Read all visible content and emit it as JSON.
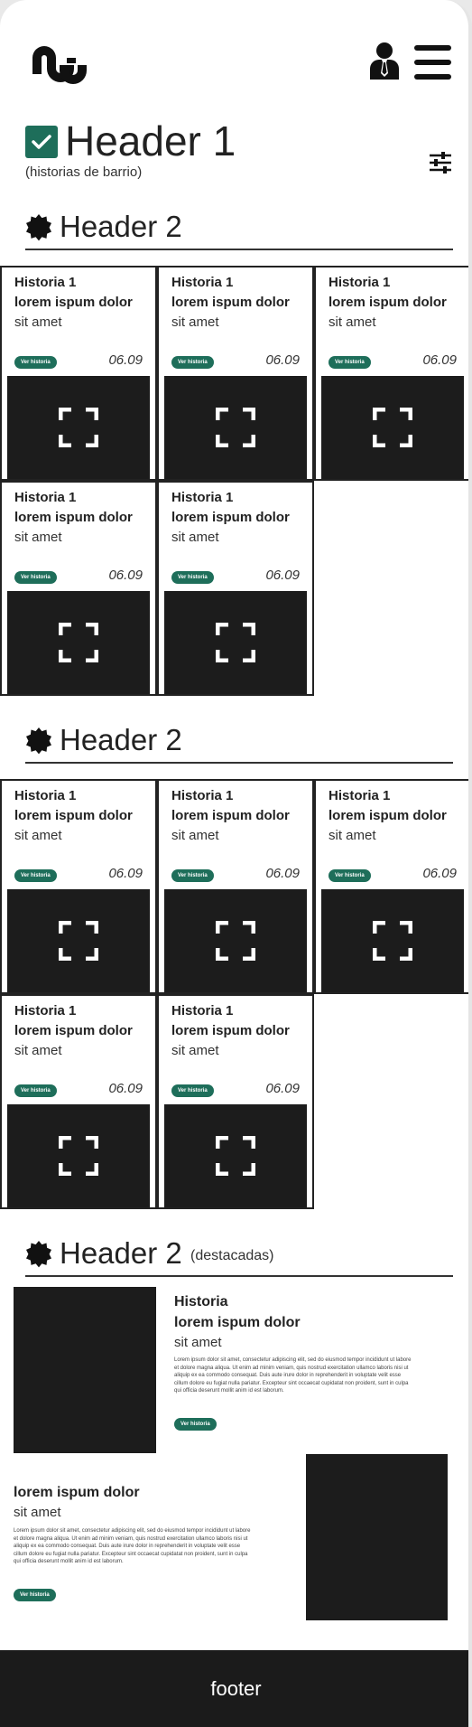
{
  "header1": {
    "title": "Header 1",
    "subtitle": "(historias de barrio)"
  },
  "sections": [
    {
      "title": "Header 2",
      "cards": [
        {
          "title": "Historia 1",
          "line2": "lorem ispum dolor",
          "line3": "sit amet",
          "button": "Ver historia",
          "date": "06.09"
        },
        {
          "title": "Historia 1",
          "line2": "lorem ispum dolor",
          "line3": "sit amet",
          "button": "Ver historia",
          "date": "06.09"
        },
        {
          "title": "Historia 1",
          "line2": "lorem ispum dolor",
          "line3": "sit amet",
          "button": "Ver historia",
          "date": "06.09"
        },
        {
          "title": "Historia 1",
          "line2": "lorem ispum dolor",
          "line3": "sit amet",
          "button": "Ver historia",
          "date": "06.09"
        },
        {
          "title": "Historia 1",
          "line2": "lorem ispum dolor",
          "line3": "sit amet",
          "button": "Ver historia",
          "date": "06.09"
        }
      ]
    },
    {
      "title": "Header 2",
      "cards": [
        {
          "title": "Historia 1",
          "line2": "lorem ispum dolor",
          "line3": "sit amet",
          "button": "Ver historia",
          "date": "06.09"
        },
        {
          "title": "Historia 1",
          "line2": "lorem ispum dolor",
          "line3": "sit amet",
          "button": "Ver historia",
          "date": "06.09"
        },
        {
          "title": "Historia 1",
          "line2": "lorem ispum dolor",
          "line3": "sit amet",
          "button": "Ver historia",
          "date": "06.09"
        },
        {
          "title": "Historia 1",
          "line2": "lorem ispum dolor",
          "line3": "sit amet",
          "button": "Ver historia",
          "date": "06.09"
        },
        {
          "title": "Historia 1",
          "line2": "lorem ispum dolor",
          "line3": "sit amet",
          "button": "Ver historia",
          "date": "06.09"
        }
      ]
    }
  ],
  "featured": {
    "title": "Header 2",
    "note": "(destacadas)",
    "items": [
      {
        "title": "Historia",
        "line2": "lorem ispum dolor",
        "line3": "sit amet",
        "body": "Lorem ipsum dolor sit amet, consectetur adipiscing elit, sed do eiusmod tempor incididunt ut labore et dolore magna aliqua. Ut enim ad minim veniam, quis nostrud exercitation ullamco laboris nisi ut aliquip ex ea commodo consequat. Duis aute irure dolor in reprehenderit in voluptate velit esse cillum dolore eu fugiat nulla pariatur. Excepteur sint occaecat cupidatat non proident, sunt in culpa qui officia deserunt mollit anim id est laborum.",
        "button": "Ver historia"
      },
      {
        "line2": "lorem ispum dolor",
        "line3": "sit amet",
        "body": "Lorem ipsum dolor sit amet, consectetur adipiscing elit, sed do eiusmod tempor incididunt ut labore et dolore magna aliqua. Ut enim ad minim veniam, quis nostrud exercitation ullamco laboris nisi ut aliquip ex ea commodo consequat. Duis aute irure dolor in reprehenderit in voluptate velit esse cillum dolore eu fugiat nulla pariatur. Excepteur sint occaecat cupidatat non proident, sunt in culpa qui officia deserunt mollit anim id est laborum.",
        "button": "Ver historia"
      }
    ]
  },
  "footer": {
    "label": "footer"
  },
  "colors": {
    "accent": "#1e6e5a",
    "dark": "#1c1c1c"
  }
}
